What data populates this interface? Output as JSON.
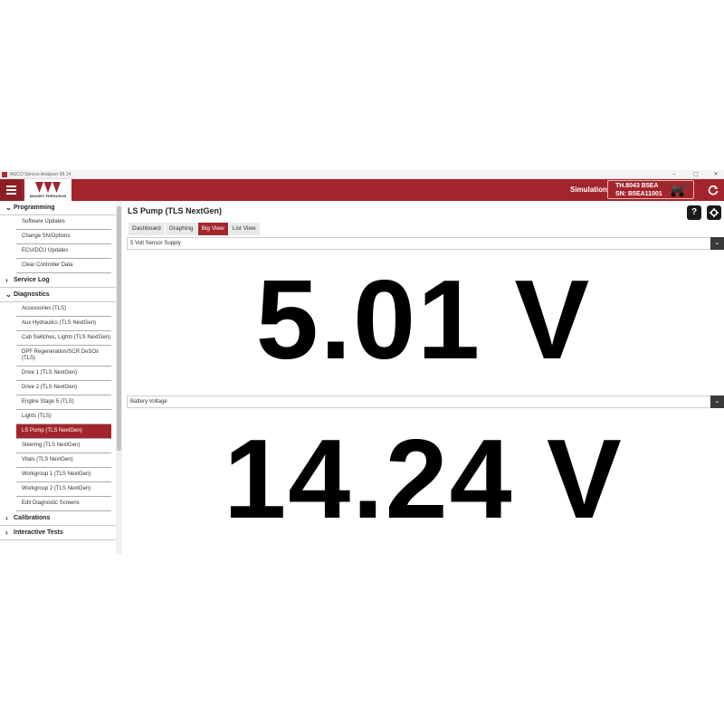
{
  "window": {
    "title": "AGCO Service Analyzer 99.14",
    "controls": {
      "minimize": "–",
      "maximize": "▢",
      "close": "✕"
    }
  },
  "header": {
    "brand": "MASSEY FERGUSON",
    "mode_label": "Simulation",
    "machine_model": "TH.8043 B5EA",
    "machine_serial": "SN: B5EA11001",
    "accent_color": "#a3252c"
  },
  "sidebar": {
    "sections": [
      {
        "label": "Programming",
        "expanded": true,
        "items": [
          "Software Updates",
          "Change SN/Options",
          "ECU/DCU Updates",
          "Clear Controller Data"
        ]
      },
      {
        "label": "Service Log",
        "expanded": false,
        "items": []
      },
      {
        "label": "Diagnostics",
        "expanded": true,
        "items": [
          "Accessories (TLS)",
          "Aux Hydraulics (TLS NextGen)",
          "Cab Switches, Lights (TLS NextGen)",
          "DPF Regeneration/SCR DeSOx (TLS)",
          "Drive 1 (TLS NextGen)",
          "Drive 2 (TLS NextGen)",
          "Engine Stage 5 (TLS)",
          "Lights (TLS)",
          "LS Pump (TLS NextGen)",
          "Steering (TLS NextGen)",
          "Vitals (TLS NextGen)",
          "Workgroup 1 (TLS NextGen)",
          "Workgroup 2 (TLS NextGen)",
          "Edit Diagnostic Screens"
        ],
        "active_item": "LS Pump (TLS NextGen)"
      },
      {
        "label": "Calibrations",
        "expanded": false,
        "items": []
      },
      {
        "label": "Interactive Tests",
        "expanded": false,
        "items": []
      }
    ]
  },
  "main": {
    "title": "LS Pump (TLS NextGen)",
    "help_icon": "question-icon",
    "settings_icon": "gear-icon",
    "tabs": [
      {
        "label": "Dashboard",
        "active": false
      },
      {
        "label": "Graphing",
        "active": false
      },
      {
        "label": "Big View",
        "active": true
      },
      {
        "label": "List View",
        "active": false
      }
    ],
    "readings": [
      {
        "parameter": "5 Volt Sensor Supply",
        "value": "5.01 V"
      },
      {
        "parameter": "Battery Voltage",
        "value": "14.24 V"
      }
    ]
  }
}
